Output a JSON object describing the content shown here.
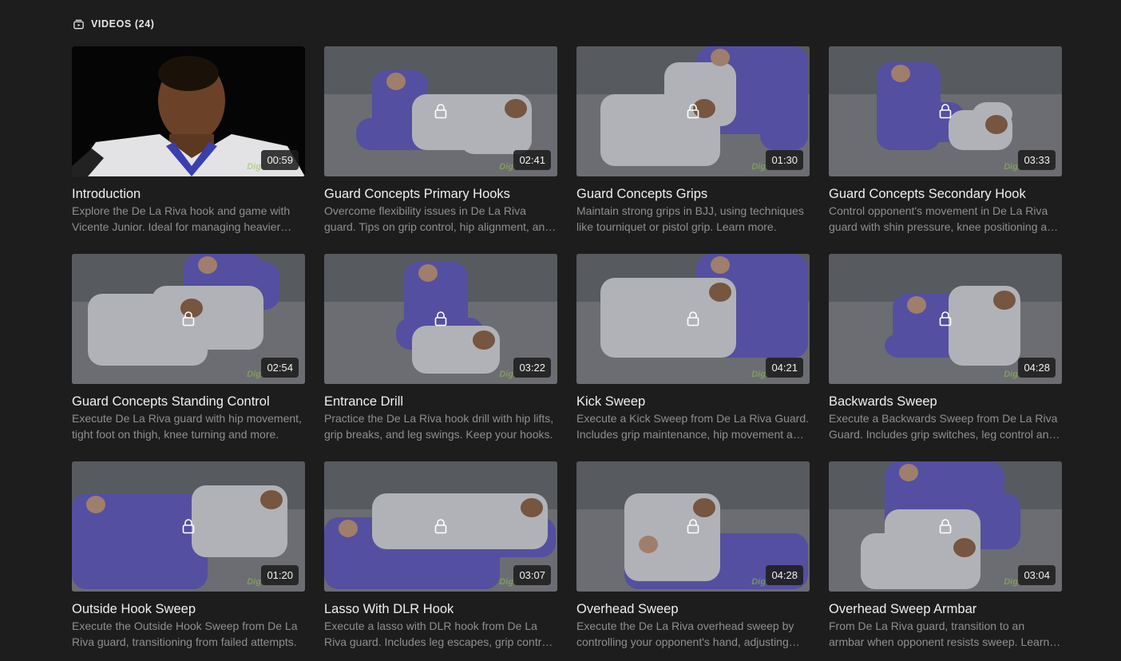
{
  "section": {
    "icon": "video-library-icon",
    "title": "VIDEOS (24)"
  },
  "watermark_text": "Digi",
  "videos": [
    {
      "title": "Introduction",
      "description": "Explore the De La Riva hook and game with Vicente Junior. Ideal for managing heavier opponents.",
      "duration": "00:59",
      "locked": false
    },
    {
      "title": "Guard Concepts Primary Hooks",
      "description": "Overcome flexibility issues in De La Riva guard. Tips on grip control, hip alignment, and hooks.",
      "duration": "02:41",
      "locked": true
    },
    {
      "title": "Guard Concepts Grips",
      "description": "Maintain strong grips in BJJ, using techniques like tourniquet or pistol grip. Learn more.",
      "duration": "01:30",
      "locked": true
    },
    {
      "title": "Guard Concepts Secondary Hook",
      "description": "Control opponent's movement in De La Riva guard with shin pressure, knee positioning and more.",
      "duration": "03:33",
      "locked": true
    },
    {
      "title": "Guard Concepts Standing Control",
      "description": "Execute De La Riva guard with hip movement, tight foot on thigh, knee turning and more.",
      "duration": "02:54",
      "locked": true
    },
    {
      "title": "Entrance Drill",
      "description": "Practice the De La Riva hook drill with hip lifts, grip breaks, and leg swings. Keep your hooks.",
      "duration": "03:22",
      "locked": true
    },
    {
      "title": "Kick Sweep",
      "description": "Execute a Kick Sweep from De La Riva Guard. Includes grip maintenance, hip movement and more.",
      "duration": "04:21",
      "locked": true
    },
    {
      "title": "Backwards Sweep",
      "description": "Execute a Backwards Sweep from De La Riva Guard. Includes grip switches, leg control and more.",
      "duration": "04:28",
      "locked": true
    },
    {
      "title": "Outside Hook Sweep",
      "description": "Execute the Outside Hook Sweep from De La Riva guard, transitioning from failed attempts.",
      "duration": "01:20",
      "locked": true
    },
    {
      "title": "Lasso With DLR Hook",
      "description": "Execute a lasso with DLR hook from De La Riva guard. Includes leg escapes, grip control and more.",
      "duration": "03:07",
      "locked": true
    },
    {
      "title": "Overhead Sweep",
      "description": "Execute the De La Riva overhead sweep by controlling your opponent's hand, adjusting your hips.",
      "duration": "04:28",
      "locked": true
    },
    {
      "title": "Overhead Sweep Armbar",
      "description": "From De La Riva guard, transition to an armbar when opponent resists sweep. Learn more.",
      "duration": "03:04",
      "locked": true
    }
  ],
  "colors": {
    "background": "#1d1d1d",
    "title": "#f0f0f0",
    "description": "#8f8f8f",
    "gi_blue": "#5a4fc0",
    "gi_white": "#d8d8dc",
    "mat": "#6d7075"
  }
}
